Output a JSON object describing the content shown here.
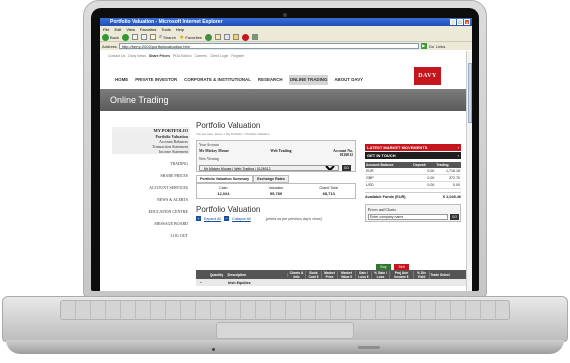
{
  "browser": {
    "title": "Portfolio Valuation - Microsoft Internet Explorer",
    "menu": [
      "File",
      "Edit",
      "View",
      "Favorites",
      "Tools",
      "Help"
    ],
    "toolbar": {
      "back": "Back",
      "search": "Search",
      "favorites": "Favorites"
    },
    "address_label": "Address",
    "address_value": "http://berry:2002/portfoliovaluation.htm",
    "go_label": "Go",
    "links_label": "Links"
  },
  "site": {
    "top_links": [
      "Contact Us",
      "Davy News",
      "Share Prices",
      "PDA Edition",
      "Careers",
      "Client Login",
      "Register"
    ],
    "nav": [
      "HOME",
      "PRIVATE INVESTOR",
      "CORPORATE & INSTITUTIONAL",
      "RESEARCH",
      "ONLINE TRADING",
      "ABOUT DAVY"
    ],
    "nav_active_index": 4,
    "logo": "DAVY",
    "banner": "Online Trading"
  },
  "sidebar": {
    "heading": "MY PORTFOLIO",
    "sub_items": [
      "Portfolio Valuation",
      "Account Balances",
      "Transaction Statement",
      "Income Statement"
    ],
    "items": [
      "TRADING",
      "SHARE PRICES",
      "ACCOUNT SERVICES",
      "NEWS & ALERTS",
      "EDUCATION CENTRE",
      "MESSAGE BOARD",
      "LOG OUT"
    ]
  },
  "main": {
    "title": "Portfolio Valuation",
    "breadcrumb": "You are here: Home > My Portfolio > Portfolio Valuation",
    "account": {
      "your_account_label": "Your Account",
      "name": "Mr Mickey Mouse",
      "type": "Web Trading",
      "account_no_label": "Account No.",
      "account_no": "0126012",
      "now_viewing_label": "Now Viewing",
      "now_viewing_value": "Mr Mickey Mouse | Web Trading | 0126012",
      "go_label": "GO"
    },
    "summary_tabs": [
      "Portfolio Valuation Summary",
      "Exchange Rates"
    ],
    "summary": [
      {
        "label": "Cash",
        "value": "12,024"
      },
      {
        "label": "Valuation",
        "value": "55,789"
      },
      {
        "label": "Grand Total",
        "value": "68,713"
      }
    ],
    "valuation_title": "Portfolio Valuation",
    "expand_all": "Expand All",
    "collapse_all": "Collapse All",
    "prices_note": "[prices as per previous day's close]",
    "buy_label": "Buy",
    "sell_label": "Sell",
    "columns": [
      "Quantity",
      "Description",
      "Charts & Info",
      "Book Cost €",
      "Market Price",
      "Market Value €",
      "Gain / Loss €",
      "% Gain / Loss",
      "Proj Ann Income €",
      "% Div Yield",
      "Trade Select"
    ],
    "row": {
      "description": "Irish Equities"
    }
  },
  "right": {
    "latest_movements": "LATEST MARKET MOVEMENTS",
    "get_in_touch": "GET IN TOUCH",
    "balances_headers": [
      "Account Balance",
      "Deposit",
      "Trading"
    ],
    "balances": [
      {
        "ccy": "EUR",
        "deposit": "0.00",
        "trading": "1,718.18"
      },
      {
        "ccy": "GBP",
        "deposit": "0.00",
        "trading": "372.70"
      },
      {
        "ccy": "USD",
        "deposit": "0.00",
        "trading": "0.00"
      }
    ],
    "available_label": "Available Funds (EUR)",
    "available_value": "€ 2,045.46",
    "prices_box_title": "Prices and Charts",
    "company_placeholder": "Enter company name",
    "go_label": "GO"
  }
}
